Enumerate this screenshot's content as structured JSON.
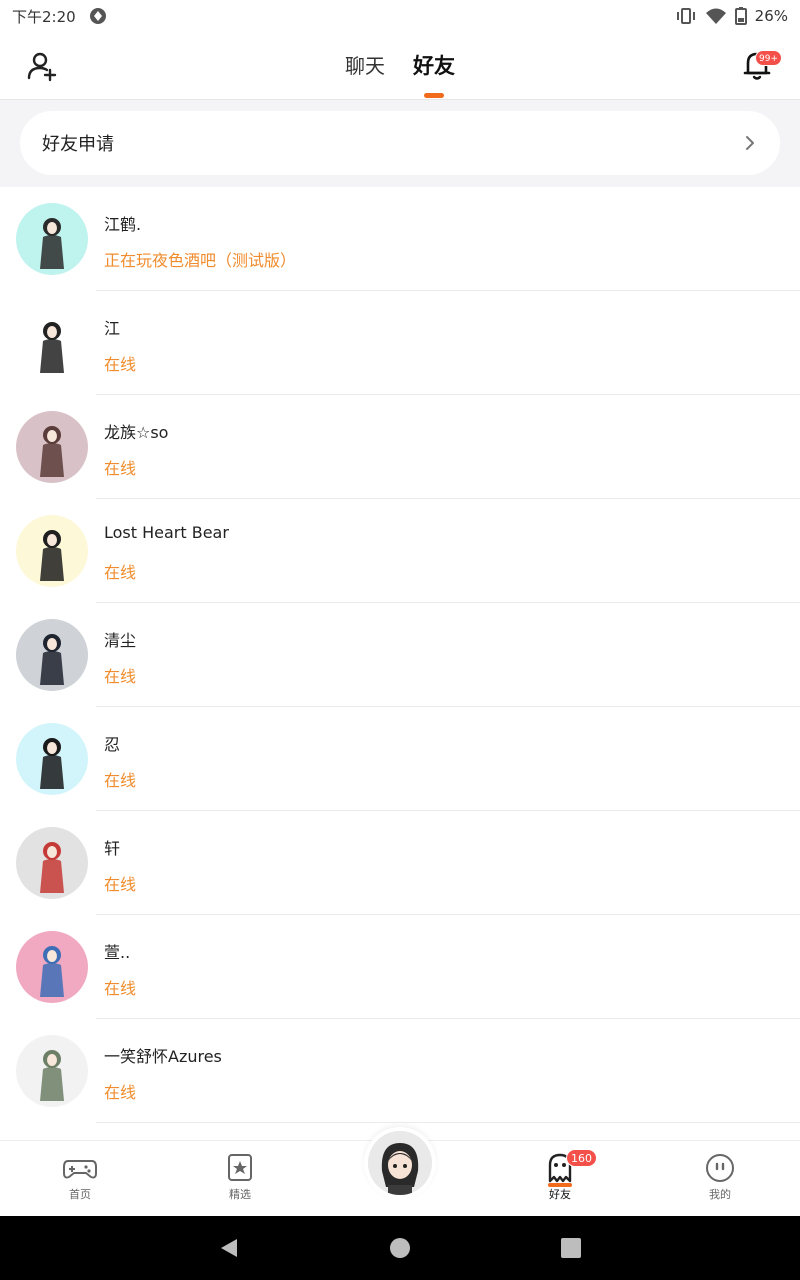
{
  "status_bar": {
    "time": "下午2:20",
    "battery": "26%"
  },
  "header": {
    "tabs": [
      {
        "label": "聊天",
        "active": false
      },
      {
        "label": "好友",
        "active": true
      }
    ],
    "notification_badge": "99+",
    "accent_color": "#f26a1b"
  },
  "friend_request": {
    "label": "好友申请"
  },
  "friends": [
    {
      "name": "江鹤.",
      "status": "正在玩夜色酒吧（测试版）",
      "avatar_bg": "#bff3ee",
      "figure_color": "#2b2b2b"
    },
    {
      "name": "江",
      "status": "在线",
      "avatar_bg": "#ffffff",
      "figure_color": "#222222"
    },
    {
      "name": "龙族☆so",
      "status": "在线",
      "avatar_bg": "#d9c2c7",
      "figure_color": "#5a3d3a"
    },
    {
      "name": "Lost Heart Bear",
      "status": "在线",
      "avatar_bg": "#fdf8d8",
      "figure_color": "#1f1f1f"
    },
    {
      "name": "清尘",
      "status": "在线",
      "avatar_bg": "#cfd2d6",
      "figure_color": "#1e2430"
    },
    {
      "name": "忍",
      "status": "在线",
      "avatar_bg": "#d2f5fb",
      "figure_color": "#1a1a1a"
    },
    {
      "name": "轩",
      "status": "在线",
      "avatar_bg": "#e2e2e2",
      "figure_color": "#c53a36"
    },
    {
      "name": "萱..",
      "status": "在线",
      "avatar_bg": "#f1a9c2",
      "figure_color": "#3e6fb6"
    },
    {
      "name": "一笑舒怀Azures",
      "status": "在线",
      "avatar_bg": "#f2f2f2",
      "figure_color": "#6d7f66"
    }
  ],
  "bottom_nav": {
    "items": [
      {
        "label": "首页",
        "icon": "gamepad-icon"
      },
      {
        "label": "精选",
        "icon": "star-bookmark-icon"
      },
      {
        "label": "好友",
        "icon": "ghost-icon",
        "active": true,
        "badge": "160"
      },
      {
        "label": "我的",
        "icon": "face-icon"
      }
    ]
  },
  "colors": {
    "status_orange": "#f08c2e",
    "badge_red": "#f4504a"
  }
}
